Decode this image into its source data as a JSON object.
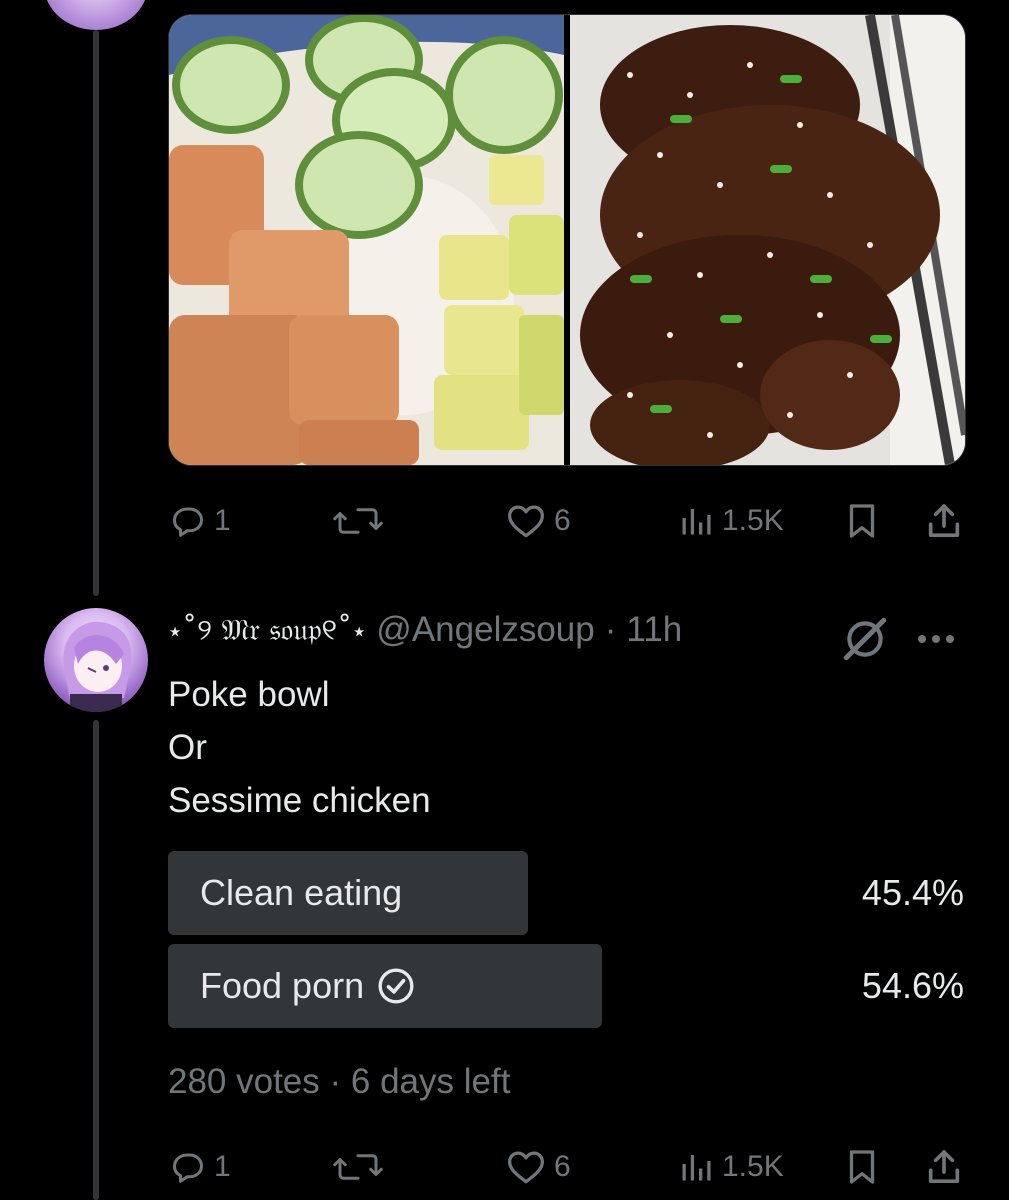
{
  "media": {
    "alt_left": "Poke bowl with salmon, cucumber, rice and avocado",
    "alt_right": "Sesame chicken with green onions"
  },
  "first_post_actions": {
    "replies": "1",
    "likes": "6",
    "views": "1.5K"
  },
  "post": {
    "display_name": "⋆˚୨ 𝔐𝔯 𝔰𝔬𝔲𝔭୧˚⋆",
    "handle": "@Angelzsoup",
    "separator": "·",
    "time": "11h",
    "lines": [
      "Poke bowl",
      "Or",
      "Sessime chicken"
    ],
    "poll": {
      "options": [
        {
          "label": "Clean eating",
          "percent_text": "45.4%",
          "percent": 45.4,
          "selected": false
        },
        {
          "label": "Food porn",
          "percent_text": "54.6%",
          "percent": 54.6,
          "selected": true
        }
      ],
      "votes": "280 votes",
      "remaining": "6 days left",
      "meta_separator": "·"
    },
    "actions": {
      "replies": "1",
      "likes": "6",
      "views": "1.5K"
    }
  },
  "colors": {
    "background": "#000000",
    "text": "#e7e9ea",
    "muted": "#71767b",
    "poll_bar": "#333639",
    "thread_line": "#333639"
  },
  "icons": [
    "reply-icon",
    "repost-icon",
    "like-icon",
    "views-icon",
    "bookmark-icon",
    "share-icon",
    "grok-icon",
    "more-icon",
    "check-circle-icon"
  ]
}
